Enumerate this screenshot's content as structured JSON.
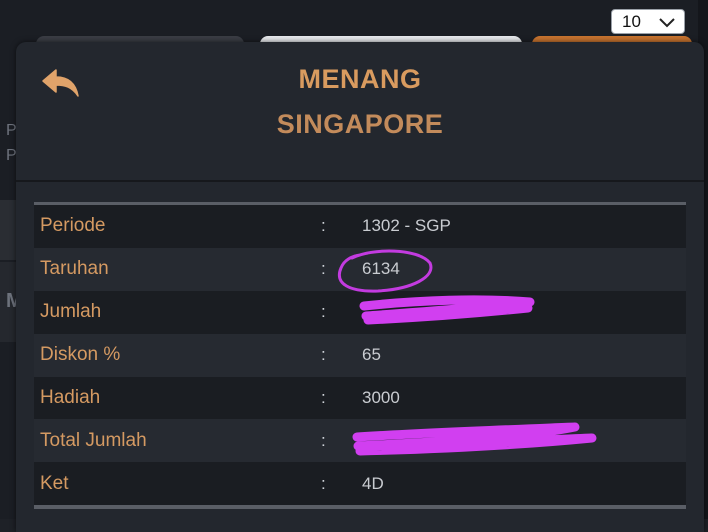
{
  "page_size_select": {
    "value": "10",
    "icon": "chevron-down-icon"
  },
  "background_letters": [
    "P",
    "P",
    "M"
  ],
  "modal": {
    "title_line1": "MENANG",
    "title_line2": "SINGAPORE",
    "back_icon": "reply-arrow-icon",
    "accent_color": "#d99b5f",
    "rows": [
      {
        "label": "Periode",
        "colon": ":",
        "value": "1302 - SGP"
      },
      {
        "label": "Taruhan",
        "colon": ":",
        "value": "6134"
      },
      {
        "label": "Jumlah",
        "colon": ":",
        "value": ""
      },
      {
        "label": "Diskon %",
        "colon": ":",
        "value": "65"
      },
      {
        "label": "Hadiah",
        "colon": ":",
        "value": "3000"
      },
      {
        "label": "Total Jumlah",
        "colon": ":",
        "value": ""
      },
      {
        "label": "Ket",
        "colon": ":",
        "value": "4D"
      }
    ]
  },
  "annotations": {
    "circle_color": "#c33be0",
    "redaction_color": "#d13ff0"
  }
}
